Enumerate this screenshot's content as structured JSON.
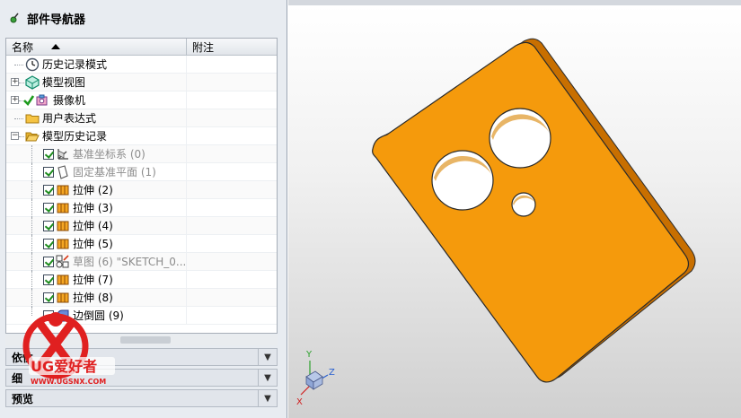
{
  "navigator": {
    "title": "部件导航器",
    "columns": {
      "name": "名称",
      "note": "附注"
    },
    "items": [
      {
        "label": "历史记录模式",
        "icon": "clock-icon"
      },
      {
        "label": "模型视图",
        "icon": "model-views-icon"
      },
      {
        "label": "摄像机",
        "icon": "camera-icon"
      },
      {
        "label": "用户表达式",
        "icon": "folder-icon"
      },
      {
        "label": "模型历史记录",
        "icon": "folder-open-icon"
      },
      {
        "label": "基准坐标系 (0)",
        "icon": "datum-csys-icon"
      },
      {
        "label": "固定基准平面 (1)",
        "icon": "datum-plane-icon"
      },
      {
        "label": "拉伸 (2)",
        "icon": "extrude-icon"
      },
      {
        "label": "拉伸 (3)",
        "icon": "extrude-icon"
      },
      {
        "label": "拉伸 (4)",
        "icon": "extrude-icon"
      },
      {
        "label": "拉伸 (5)",
        "icon": "extrude-icon"
      },
      {
        "label": "草图 (6) \"SKETCH_0...",
        "icon": "sketch-icon"
      },
      {
        "label": "拉伸 (7)",
        "icon": "extrude-icon"
      },
      {
        "label": "拉伸 (8)",
        "icon": "extrude-icon"
      },
      {
        "label": "边倒圆 (9)",
        "icon": "edge-blend-icon"
      }
    ],
    "panels": [
      {
        "label": "依性"
      },
      {
        "label": "细"
      },
      {
        "label": "预览"
      }
    ]
  },
  "watermark": {
    "brand": "UG爱好者",
    "url": "WWW.UGSNX.COM"
  },
  "triad": {
    "x": "X",
    "y": "Y",
    "z": "Z"
  },
  "colors": {
    "part": "#f59a0c",
    "part_edge": "#2a2a2a",
    "check": "#1d8c1d",
    "logo_red": "#e02020"
  }
}
